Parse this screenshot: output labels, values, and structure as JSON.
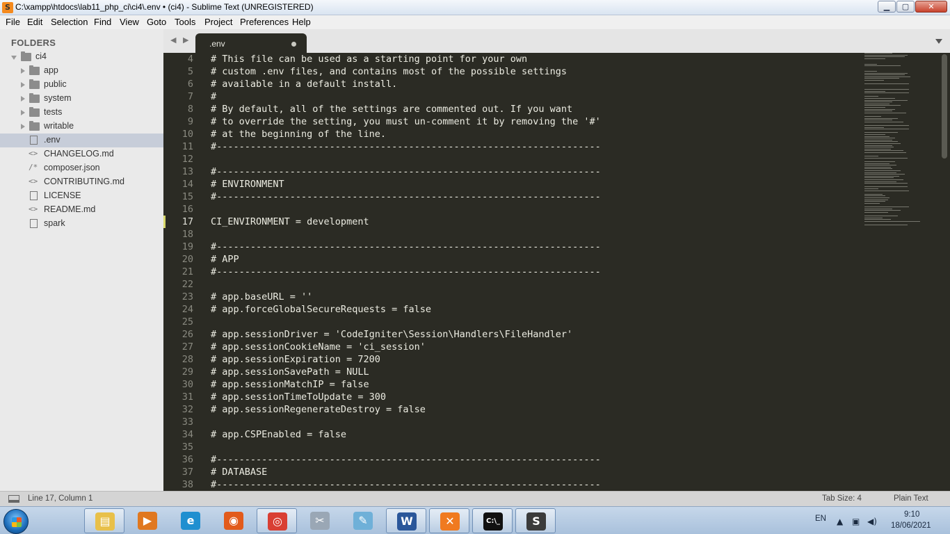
{
  "window": {
    "title": "C:\\xampp\\htdocs\\lab11_php_ci\\ci4\\.env • (ci4) - Sublime Text (UNREGISTERED)",
    "minimize_glyph": "▁",
    "maximize_glyph": "▢",
    "close_glyph": "✕"
  },
  "menu": [
    "File",
    "Edit",
    "Selection",
    "Find",
    "View",
    "Goto",
    "Tools",
    "Project",
    "Preferences",
    "Help"
  ],
  "sidebar": {
    "header": "FOLDERS",
    "root": "ci4",
    "folders": [
      "app",
      "public",
      "system",
      "tests",
      "writable"
    ],
    "files": [
      {
        "name": ".env",
        "icon": "file-icon",
        "selected": true
      },
      {
        "name": "CHANGELOG.md",
        "icon": "code-icon",
        "glyph": "<>"
      },
      {
        "name": "composer.json",
        "icon": "code-icon",
        "glyph": "/*"
      },
      {
        "name": "CONTRIBUTING.md",
        "icon": "code-icon",
        "glyph": "<>"
      },
      {
        "name": "LICENSE",
        "icon": "file-icon"
      },
      {
        "name": "README.md",
        "icon": "code-icon",
        "glyph": "<>"
      },
      {
        "name": "spark",
        "icon": "file-icon"
      }
    ]
  },
  "tabs": {
    "nav": "◀ ▶",
    "active_tab": ".env",
    "dirty": true
  },
  "editor": {
    "current_line": 17,
    "lines": [
      {
        "n": 4,
        "text": "# This file can be used as a starting point for your own"
      },
      {
        "n": 5,
        "text": "# custom .env files, and contains most of the possible settings"
      },
      {
        "n": 6,
        "text": "# available in a default install."
      },
      {
        "n": 7,
        "text": "#"
      },
      {
        "n": 8,
        "text": "# By default, all of the settings are commented out. If you want"
      },
      {
        "n": 9,
        "text": "# to override the setting, you must un-comment it by removing the '#'"
      },
      {
        "n": 10,
        "text": "# at the beginning of the line."
      },
      {
        "n": 11,
        "text": "#--------------------------------------------------------------------"
      },
      {
        "n": 12,
        "text": ""
      },
      {
        "n": 13,
        "text": "#--------------------------------------------------------------------"
      },
      {
        "n": 14,
        "text": "# ENVIRONMENT"
      },
      {
        "n": 15,
        "text": "#--------------------------------------------------------------------"
      },
      {
        "n": 16,
        "text": ""
      },
      {
        "n": 17,
        "text": "CI_ENVIRONMENT = development"
      },
      {
        "n": 18,
        "text": ""
      },
      {
        "n": 19,
        "text": "#--------------------------------------------------------------------"
      },
      {
        "n": 20,
        "text": "# APP"
      },
      {
        "n": 21,
        "text": "#--------------------------------------------------------------------"
      },
      {
        "n": 22,
        "text": ""
      },
      {
        "n": 23,
        "text": "# app.baseURL = ''"
      },
      {
        "n": 24,
        "text": "# app.forceGlobalSecureRequests = false"
      },
      {
        "n": 25,
        "text": ""
      },
      {
        "n": 26,
        "text": "# app.sessionDriver = 'CodeIgniter\\Session\\Handlers\\FileHandler'"
      },
      {
        "n": 27,
        "text": "# app.sessionCookieName = 'ci_session'"
      },
      {
        "n": 28,
        "text": "# app.sessionExpiration = 7200"
      },
      {
        "n": 29,
        "text": "# app.sessionSavePath = NULL"
      },
      {
        "n": 30,
        "text": "# app.sessionMatchIP = false"
      },
      {
        "n": 31,
        "text": "# app.sessionTimeToUpdate = 300"
      },
      {
        "n": 32,
        "text": "# app.sessionRegenerateDestroy = false"
      },
      {
        "n": 33,
        "text": ""
      },
      {
        "n": 34,
        "text": "# app.CSPEnabled = false"
      },
      {
        "n": 35,
        "text": ""
      },
      {
        "n": 36,
        "text": "#--------------------------------------------------------------------"
      },
      {
        "n": 37,
        "text": "# DATABASE"
      },
      {
        "n": 38,
        "text": "#--------------------------------------------------------------------"
      }
    ]
  },
  "status": {
    "position": "Line 17, Column 1",
    "tab_size": "Tab Size: 4",
    "syntax": "Plain Text"
  },
  "taskbar": {
    "apps": [
      {
        "name": "windows-explorer",
        "icon": "folder-icon",
        "color": "#e8c04a",
        "glyph": "▤"
      },
      {
        "name": "media-player",
        "icon": "media-player-icon",
        "color": "#e07820",
        "glyph": "▶"
      },
      {
        "name": "edge",
        "icon": "edge-icon",
        "color": "#1f8fd0",
        "glyph": "e"
      },
      {
        "name": "firefox",
        "icon": "firefox-icon",
        "color": "#e25b1c",
        "glyph": "◉"
      },
      {
        "name": "chrome",
        "icon": "chrome-icon",
        "color": "#d93f33",
        "glyph": "◎"
      },
      {
        "name": "snipping-tool",
        "icon": "scissors-icon",
        "color": "#9aa7b5",
        "glyph": "✂"
      },
      {
        "name": "notepad",
        "icon": "notepad-icon",
        "color": "#6fb0d8",
        "glyph": "✎"
      },
      {
        "name": "word",
        "icon": "word-icon",
        "color": "#2b579a",
        "glyph": "W"
      },
      {
        "name": "xampp",
        "icon": "xampp-icon",
        "color": "#f07a20",
        "glyph": "✕"
      },
      {
        "name": "cmd",
        "icon": "terminal-icon",
        "color": "#111111",
        "glyph": "C:\\_"
      },
      {
        "name": "sublime",
        "icon": "sublime-icon",
        "color": "#3b3b3b",
        "glyph": "S"
      }
    ],
    "language": "EN",
    "time": "9:10",
    "date": "18/06/2021"
  }
}
